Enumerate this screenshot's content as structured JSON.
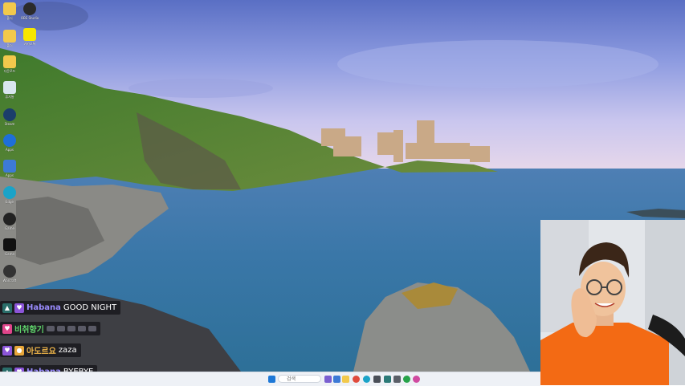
{
  "desktop": {
    "icons": [
      {
        "name": "folder-icon",
        "label": "폴더"
      },
      {
        "name": "app-icon",
        "label": "OBS Studio"
      },
      {
        "name": "folder-icon",
        "label": "폴더"
      },
      {
        "name": "kakaotalk-icon",
        "label": "카카오톡"
      },
      {
        "name": "folder-icon",
        "label": "다운로드"
      },
      {
        "name": "recycle-bin-icon",
        "label": "휴지통"
      },
      {
        "name": "steam-icon",
        "label": "Steam"
      },
      {
        "name": "app-icon",
        "label": "Apps"
      },
      {
        "name": "app-icon",
        "label": "Apps"
      },
      {
        "name": "edge-icon",
        "label": "Edge"
      },
      {
        "name": "app-icon",
        "label": "Game"
      },
      {
        "name": "app-icon",
        "label": "Game"
      },
      {
        "name": "warcraft-icon",
        "label": "Warcraft"
      }
    ]
  },
  "chat": [
    {
      "user": "Habana",
      "message": "GOOD NIGHT",
      "badge_color": "#e05aa0",
      "user_color": "#9b8cff"
    },
    {
      "user": "비취향기",
      "message": "",
      "badge_color": "#e0458a",
      "user_color": "#5fd36b"
    },
    {
      "user": "아도르요",
      "message": "zaza",
      "badge_color": "#e0458a",
      "user_color": "#f3b84a"
    },
    {
      "user": "Habana",
      "message": "BYEBYE",
      "badge_color": "#e05aa0",
      "user_color": "#9b8cff"
    }
  ],
  "taskbar": {
    "search_placeholder": "검색"
  }
}
